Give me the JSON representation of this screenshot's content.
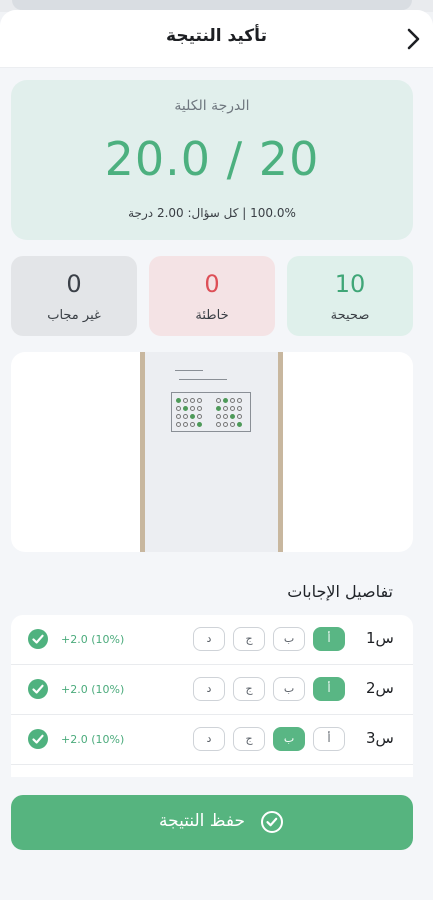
{
  "header": {
    "title": "تأكيد النتيجة"
  },
  "score": {
    "label": "الدرجة الكلية",
    "value": "20.0 / 20",
    "summary": "100.0% | كل سؤال: 2.00 درجة"
  },
  "stats": {
    "correct": {
      "count": "10",
      "label": "صحيحة"
    },
    "wrong": {
      "count": "0",
      "label": "خاطئة"
    },
    "unanswered": {
      "count": "0",
      "label": "غير مجاب"
    }
  },
  "details_title": "تفاصيل الإجابات",
  "questions": [
    {
      "label": "س1",
      "options": [
        "أ",
        "ب",
        "ج",
        "د"
      ],
      "selected": 0,
      "points": "+2.0 (10%)"
    },
    {
      "label": "س2",
      "options": [
        "أ",
        "ب",
        "ج",
        "د"
      ],
      "selected": 0,
      "points": "+2.0 (10%)"
    },
    {
      "label": "س3",
      "options": [
        "أ",
        "ب",
        "ج",
        "د"
      ],
      "selected": 1,
      "points": "+2.0 (10%)"
    }
  ],
  "save_button": {
    "label": "حفظ النتيجة"
  },
  "colors": {
    "accent": "#56b47f",
    "correct": "#3fa677",
    "wrong": "#dd4f57"
  }
}
